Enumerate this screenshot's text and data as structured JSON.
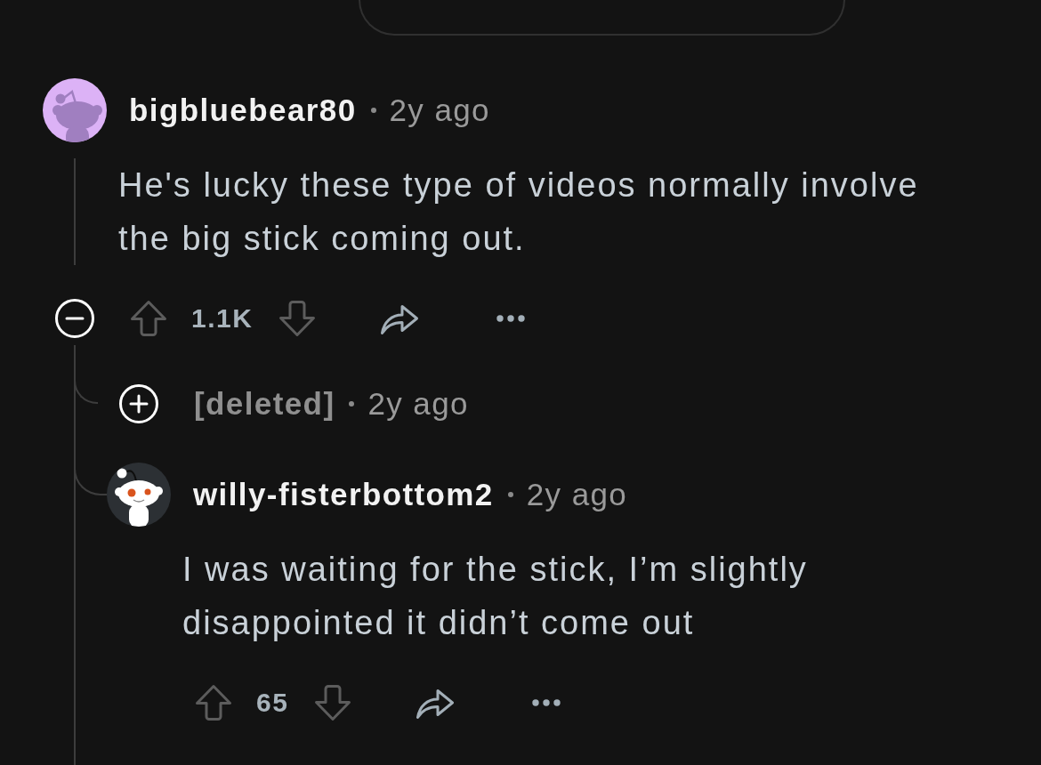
{
  "comment": {
    "author": "bigbluebear80",
    "deleted": false,
    "age": "2y ago",
    "body": "He's lucky these type of videos normally involve the big stick coming out.",
    "expanded": true,
    "votes": "1.1K",
    "replies": [
      {
        "kind": "collapsed",
        "author": "[deleted]",
        "deleted": true,
        "age": "2y ago"
      },
      {
        "kind": "comment",
        "author": "willy-fisterbottom2",
        "deleted": false,
        "age": "2y ago",
        "body": "I was waiting for the stick, I’m slightly disappointed it didn’t come out",
        "votes": "65"
      }
    ]
  }
}
